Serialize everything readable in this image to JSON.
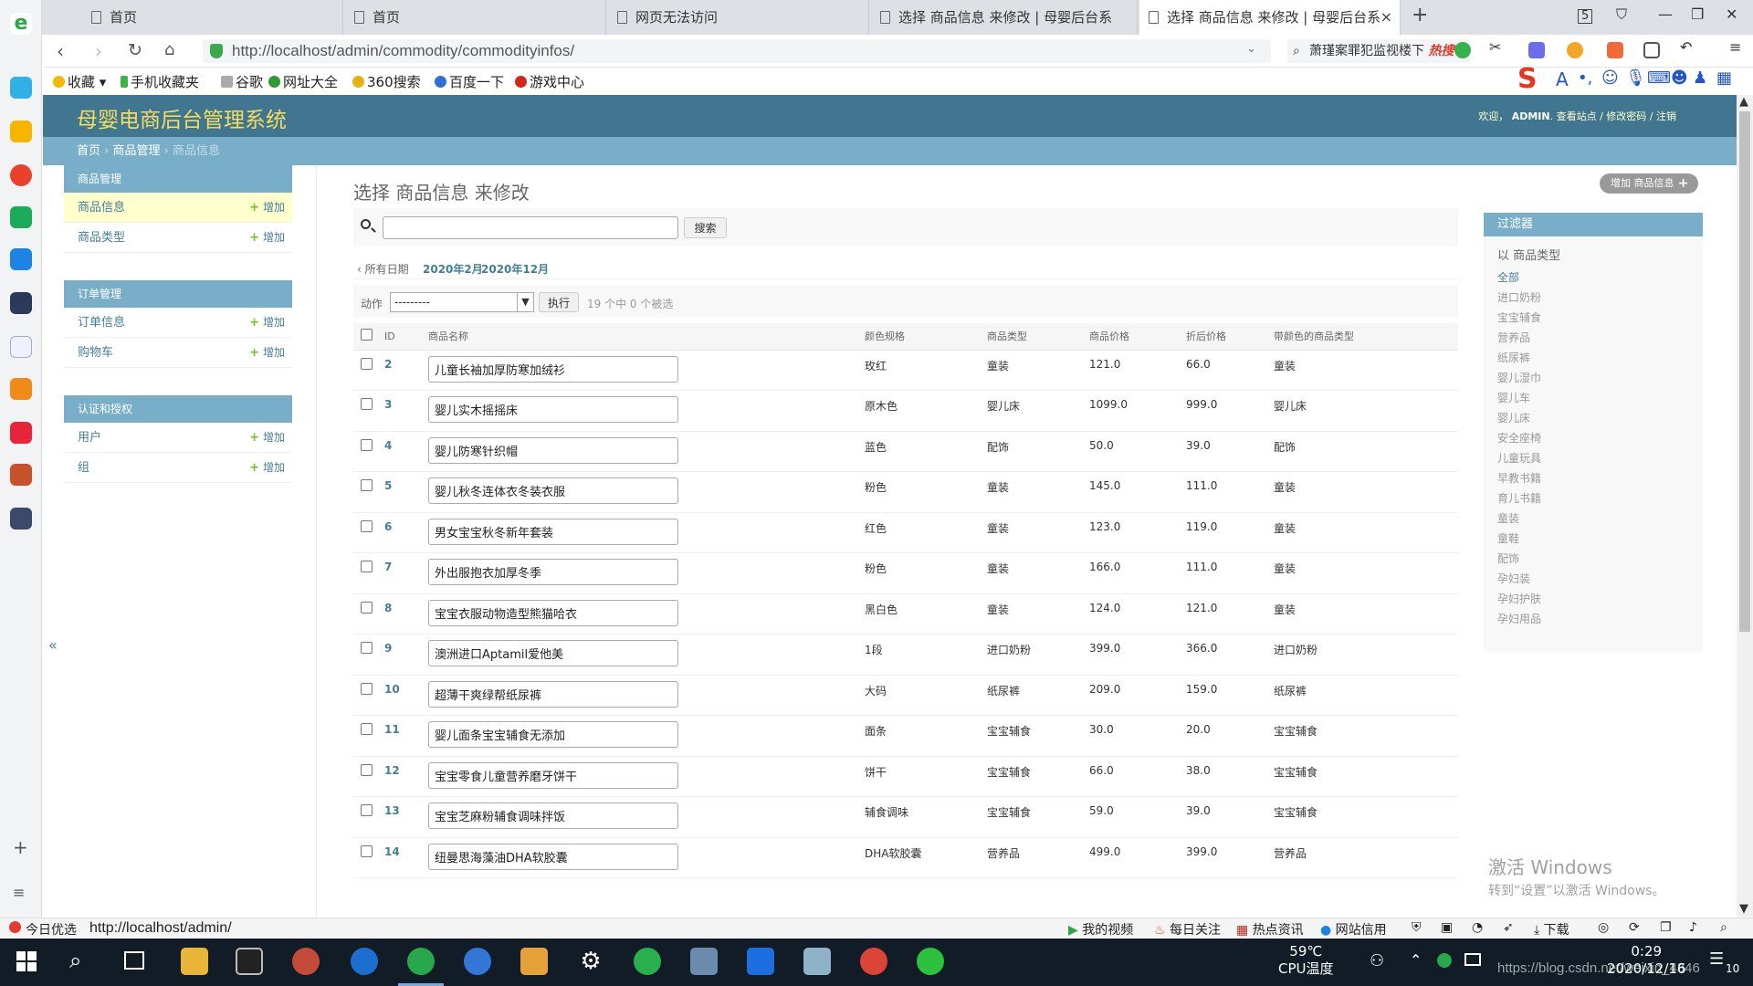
{
  "browser": {
    "tabs": [
      {
        "label": "首页"
      },
      {
        "label": "首页"
      },
      {
        "label": "网页无法访问"
      },
      {
        "label": "选择 商品信息 来修改 | 母婴后台系"
      },
      {
        "label": "选择 商品信息 来修改 | 母婴后台系",
        "active": true
      }
    ],
    "url": "http://localhost/admin/commodity/commodityinfos/",
    "hot_search_text": "萧瑾案罪犯监视楼下",
    "hot_label": "热搜",
    "bookmarks": [
      "收藏",
      "手机收藏夹",
      "谷歌",
      "网址大全",
      "360搜索",
      "百度一下",
      "游戏中心"
    ],
    "tab_count": "5"
  },
  "admin": {
    "site_title": "母婴电商后台管理系统",
    "user_tools": {
      "welcome": "欢迎，",
      "user": "ADMIN",
      "links": "查看站点 / 修改密码 / 注销"
    },
    "breadcrumbs": {
      "home": "首页",
      "app": "商品管理",
      "current": "商品信息"
    },
    "nav": [
      {
        "caption": "商品管理",
        "items": [
          {
            "label": "商品信息",
            "add": "增加",
            "selected": true
          },
          {
            "label": "商品类型",
            "add": "增加"
          }
        ]
      },
      {
        "caption": "订单管理",
        "items": [
          {
            "label": "订单信息",
            "add": "增加"
          },
          {
            "label": "购物车",
            "add": "增加"
          }
        ]
      },
      {
        "caption": "认证和授权",
        "items": [
          {
            "label": "用户",
            "add": "增加"
          },
          {
            "label": "组",
            "add": "增加"
          }
        ]
      }
    ],
    "collapse_glyph": "«",
    "page_title": "选择 商品信息 来修改",
    "add_button": "增加 商品信息",
    "search": {
      "value": "",
      "button": "搜索"
    },
    "date_hierarchy": {
      "all": "‹ 所有日期",
      "links": [
        "2020年2月",
        "2020年12月"
      ]
    },
    "actions": {
      "label": "动作",
      "selected": "---------",
      "go": "执行",
      "counter": "19 个中 0 个被选"
    },
    "table": {
      "headers": [
        "ID",
        "商品名称",
        "颜色规格",
        "商品类型",
        "商品价格",
        "折后价格",
        "带颜色的商品类型"
      ],
      "rows": [
        {
          "id": "2",
          "name": "儿童长袖加厚防寒加绒衫",
          "color": "玫红",
          "type": "童装",
          "price": "121.0",
          "discount": "66.0",
          "colored_type": "童装",
          "c": "red"
        },
        {
          "id": "3",
          "name": "婴儿实木摇摇床",
          "color": "原木色",
          "type": "婴儿床",
          "price": "1099.0",
          "discount": "999.0",
          "colored_type": "婴儿床",
          "c": "blue"
        },
        {
          "id": "4",
          "name": "婴儿防寒针织帽",
          "color": "蓝色",
          "type": "配饰",
          "price": "50.0",
          "discount": "39.0",
          "colored_type": "配饰",
          "c": "blue"
        },
        {
          "id": "5",
          "name": "婴儿秋冬连体衣冬装衣服",
          "color": "粉色",
          "type": "童装",
          "price": "145.0",
          "discount": "111.0",
          "colored_type": "童装",
          "c": "red"
        },
        {
          "id": "6",
          "name": "男女宝宝秋冬新年套装",
          "color": "红色",
          "type": "童装",
          "price": "123.0",
          "discount": "119.0",
          "colored_type": "童装",
          "c": "red"
        },
        {
          "id": "7",
          "name": "外出服抱衣加厚冬季",
          "color": "粉色",
          "type": "童装",
          "price": "166.0",
          "discount": "111.0",
          "colored_type": "童装",
          "c": "red"
        },
        {
          "id": "8",
          "name": "宝宝衣服动物造型熊猫哈衣",
          "color": "黑白色",
          "type": "童装",
          "price": "124.0",
          "discount": "121.0",
          "colored_type": "童装",
          "c": "red"
        },
        {
          "id": "9",
          "name": "澳洲进口Aptamil爱他美",
          "color": "1段",
          "type": "进口奶粉",
          "price": "399.0",
          "discount": "366.0",
          "colored_type": "进口奶粉",
          "c": "blue"
        },
        {
          "id": "10",
          "name": "超薄干爽绿帮纸尿裤",
          "color": "大码",
          "type": "纸尿裤",
          "price": "209.0",
          "discount": "159.0",
          "colored_type": "纸尿裤",
          "c": "blue"
        },
        {
          "id": "11",
          "name": "婴儿面条宝宝辅食无添加",
          "color": "面条",
          "type": "宝宝辅食",
          "price": "30.0",
          "discount": "20.0",
          "colored_type": "宝宝辅食",
          "c": "blue"
        },
        {
          "id": "12",
          "name": "宝宝零食儿童营养磨牙饼干",
          "color": "饼干",
          "type": "宝宝辅食",
          "price": "66.0",
          "discount": "38.0",
          "colored_type": "宝宝辅食",
          "c": "blue"
        },
        {
          "id": "13",
          "name": "宝宝芝麻粉辅食调味拌饭",
          "color": "辅食调味",
          "type": "宝宝辅食",
          "price": "59.0",
          "discount": "39.0",
          "colored_type": "宝宝辅食",
          "c": "blue"
        },
        {
          "id": "14",
          "name": "纽曼思海藻油DHA软胶囊",
          "color": "DHA软胶囊",
          "type": "营养品",
          "price": "499.0",
          "discount": "399.0",
          "colored_type": "营养品",
          "c": "blue"
        }
      ]
    },
    "filter": {
      "caption": "过滤器",
      "by": "以 商品类型",
      "items": [
        "全部",
        "进口奶粉",
        "宝宝辅食",
        "营养品",
        "纸尿裤",
        "婴儿湿巾",
        "婴儿车",
        "婴儿床",
        "安全座椅",
        "儿童玩具",
        "早教书籍",
        "育儿书籍",
        "童装",
        "童鞋",
        "配饰",
        "孕妇装",
        "孕妇护肤",
        "孕妇用品"
      ]
    },
    "colors": {
      "header": "#417690",
      "caption": "#79aec8",
      "title": "#f5dd5d",
      "link": "#447e9b",
      "red": "#e60000",
      "blue": "#0033ee"
    }
  },
  "watermark": {
    "line1": "激活 Windows",
    "line2": "转到“设置”以激活 Windows。"
  },
  "statusbar": {
    "left": "今日优选",
    "url": "http://localhost/admin/",
    "items": [
      "我的视频",
      "每日关注",
      "热点资讯",
      "网站信用",
      "下载"
    ]
  },
  "taskbar": {
    "weather": "59℃",
    "cpu": "CPU温度",
    "time": "0:29",
    "date": "2020/12/16",
    "csdn": "https://blog.csdn.net/weixin_4346",
    "notif": "10"
  }
}
